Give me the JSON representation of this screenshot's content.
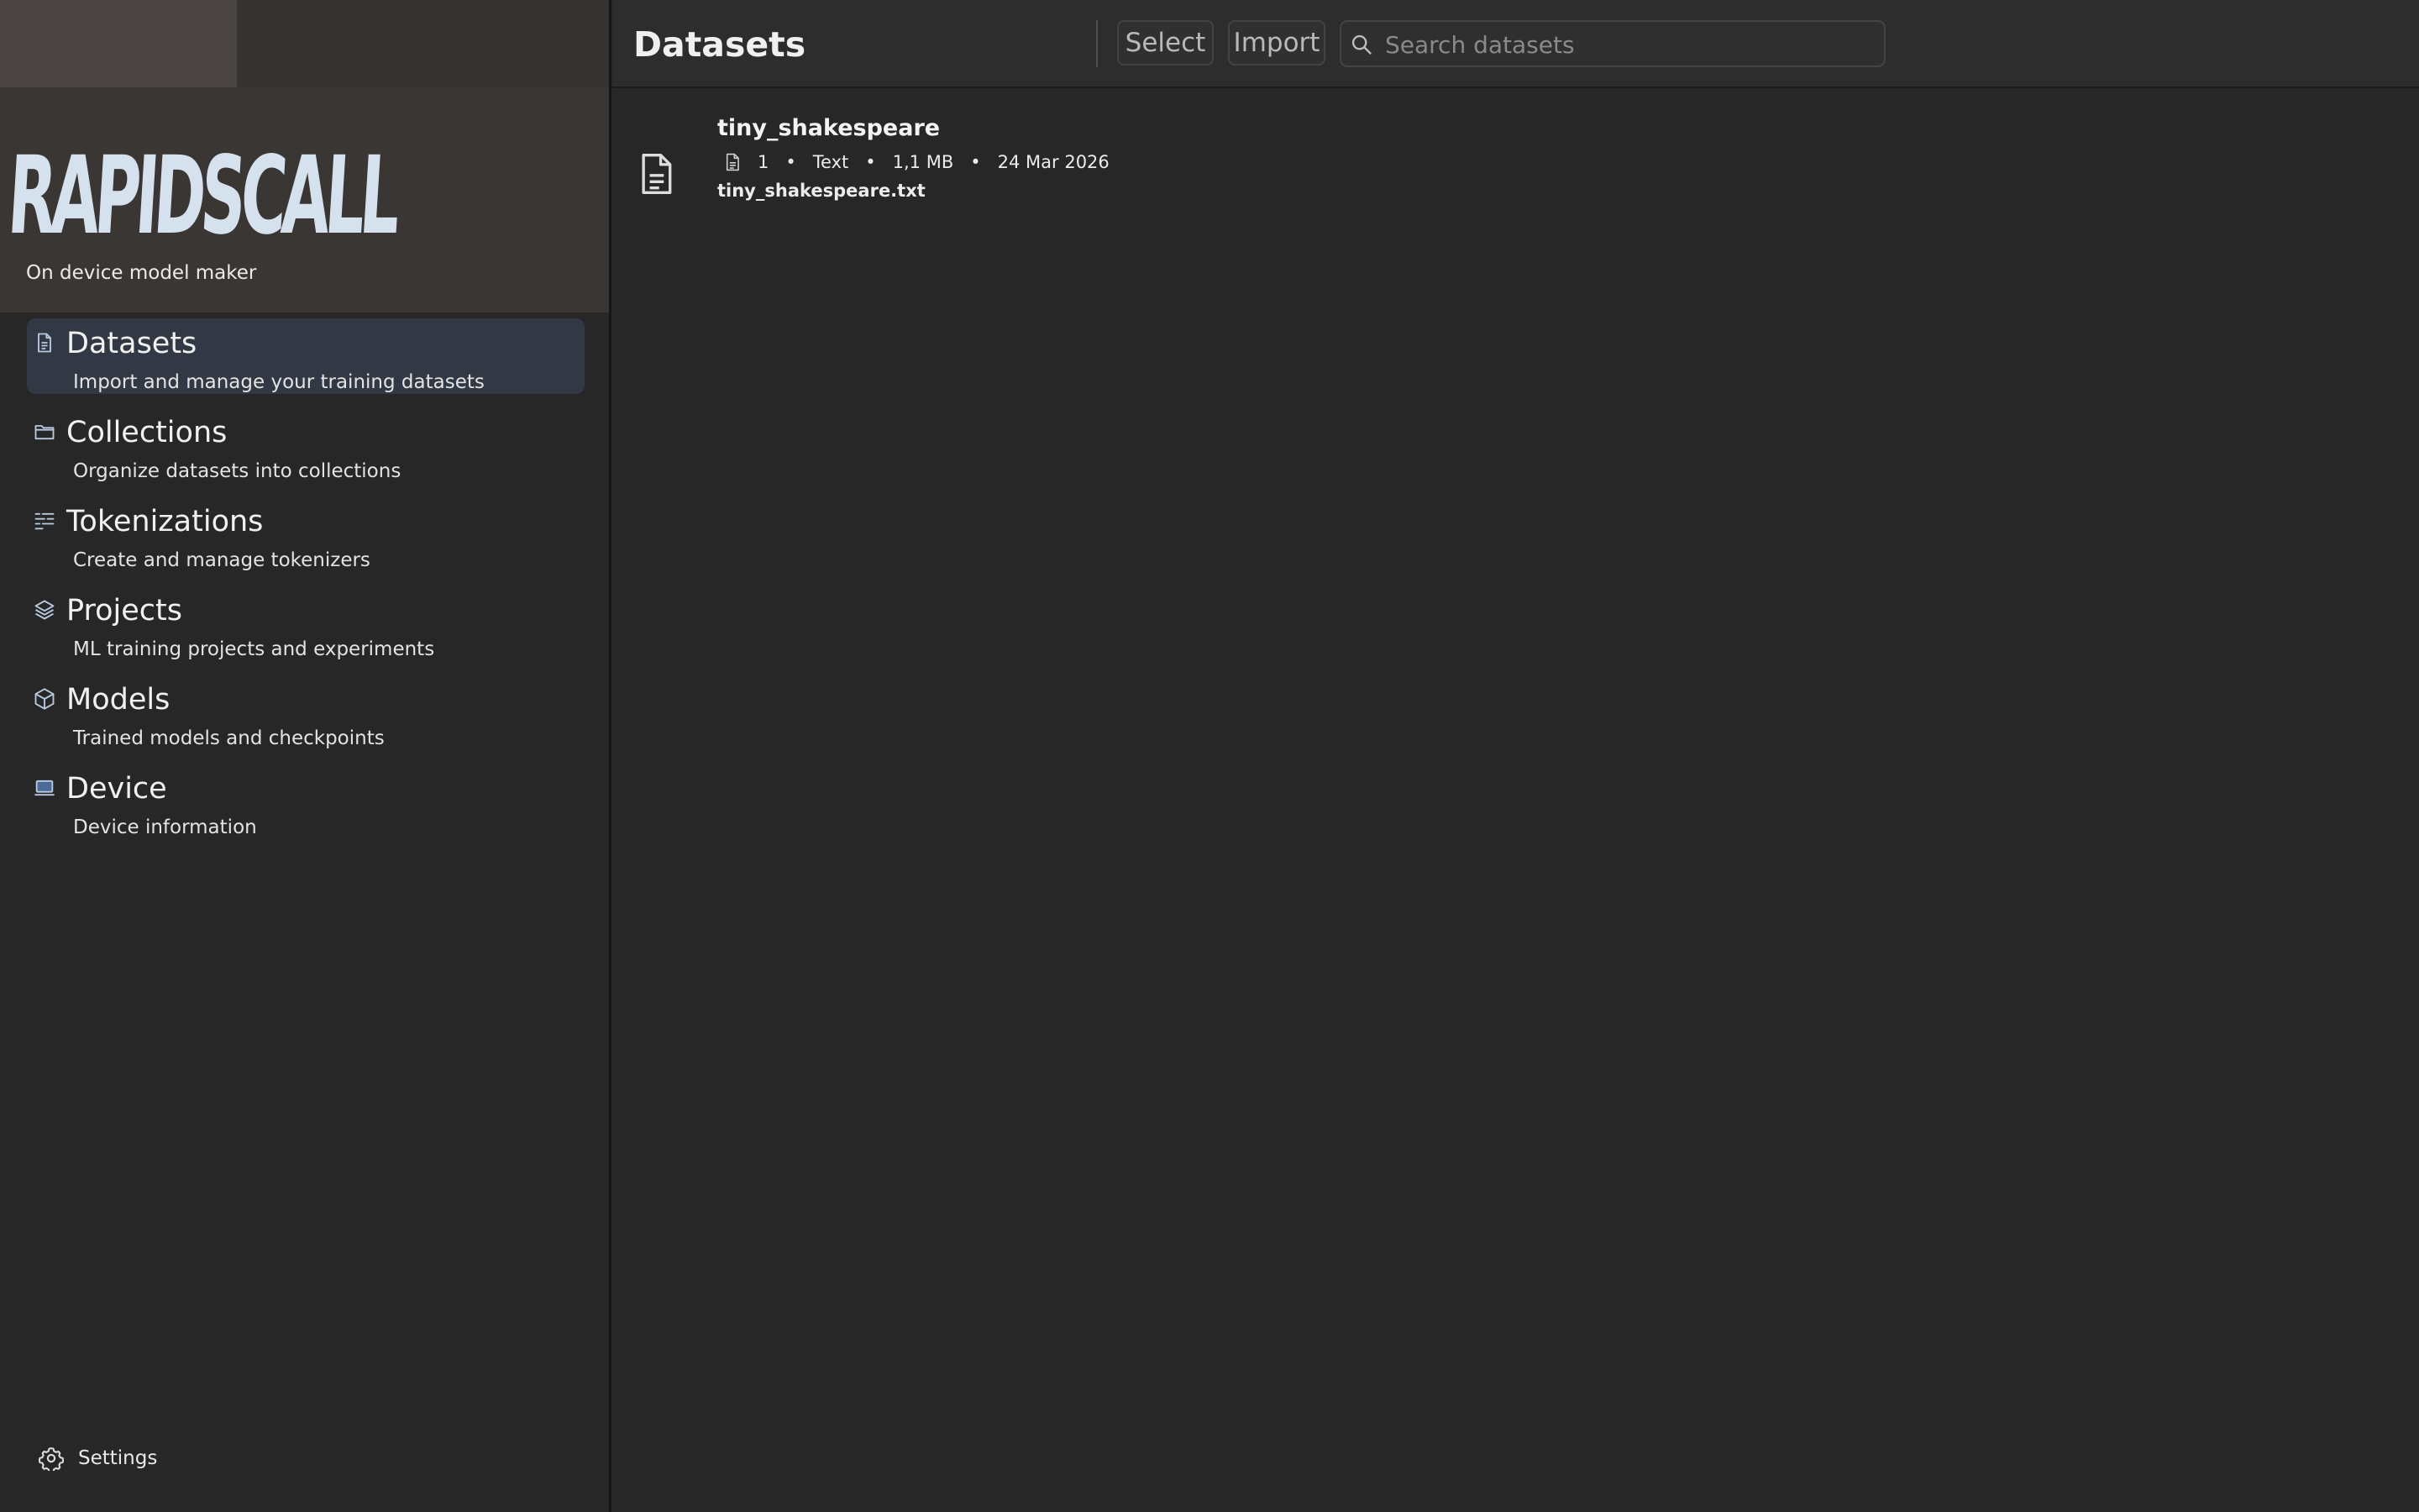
{
  "brand": {
    "logo_text": "RAPIDSCALL",
    "tagline": "On device model maker"
  },
  "sidebar": {
    "items": [
      {
        "title": "Datasets",
        "description": "Import and manage your training datasets",
        "icon": "document-icon",
        "active": true
      },
      {
        "title": "Collections",
        "description": "Organize datasets into collections",
        "icon": "folder-icon",
        "active": false
      },
      {
        "title": "Tokenizations",
        "description": "Create and manage tokenizers",
        "icon": "tokenizer-lines-icon",
        "active": false
      },
      {
        "title": "Projects",
        "description": "ML training projects and experiments",
        "icon": "layers-icon",
        "active": false
      },
      {
        "title": "Models",
        "description": "Trained models and checkpoints",
        "icon": "cube-icon",
        "active": false
      },
      {
        "title": "Device",
        "description": "Device information",
        "icon": "laptop-icon",
        "active": false
      }
    ],
    "settings_label": "Settings"
  },
  "header": {
    "title": "Datasets",
    "select_label": "Select",
    "import_label": "Import",
    "search_placeholder": "Search datasets",
    "search_value": ""
  },
  "datasets": [
    {
      "name": "tiny_shakespeare",
      "file_count": "1",
      "type": "Text",
      "size": "1,1 MB",
      "date": "24 Mar 2026",
      "filename": "tiny_shakespeare.txt"
    }
  ],
  "colors": {
    "background": "#272727",
    "active_nav": "#323944",
    "logo": "#d6e1ee",
    "icon_accent": "#b9c9e0"
  }
}
